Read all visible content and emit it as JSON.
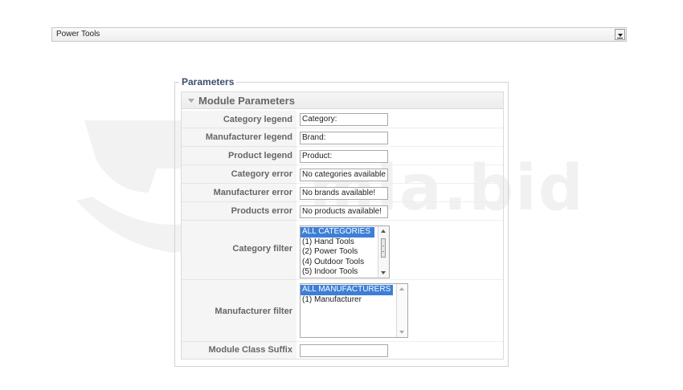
{
  "top_select": {
    "value": "Power Tools"
  },
  "watermark": {
    "text": "mla.bid"
  },
  "fieldset": {
    "legend": "Parameters"
  },
  "panel": {
    "title": "Module Parameters",
    "rows": [
      {
        "label": "Category legend",
        "value": "Category:"
      },
      {
        "label": "Manufacturer legend",
        "value": "Brand:"
      },
      {
        "label": "Product legend",
        "value": "Product:"
      },
      {
        "label": "Category error",
        "value": "No categories available"
      },
      {
        "label": "Manufacturer error",
        "value": "No brands available!"
      },
      {
        "label": "Products error",
        "value": "No products available!"
      }
    ],
    "category_filter": {
      "label": "Category filter",
      "options": [
        "ALL CATEGORIES",
        "(1) Hand Tools",
        "(2) Power Tools",
        "(4) Outdoor Tools",
        "(5) Indoor Tools"
      ],
      "selected": "ALL CATEGORIES"
    },
    "manufacturer_filter": {
      "label": "Manufacturer filter",
      "options": [
        "ALL MANUFACTURERS",
        "(1) Manufacturer"
      ],
      "selected": "ALL MANUFACTURERS"
    },
    "module_class_suffix": {
      "label": "Module Class Suffix",
      "value": ""
    }
  },
  "colors": {
    "selection": "#3d7fd6",
    "legend_text": "#3a4f6b",
    "label_text": "#666666",
    "label_bg": "#f5f5f5"
  }
}
